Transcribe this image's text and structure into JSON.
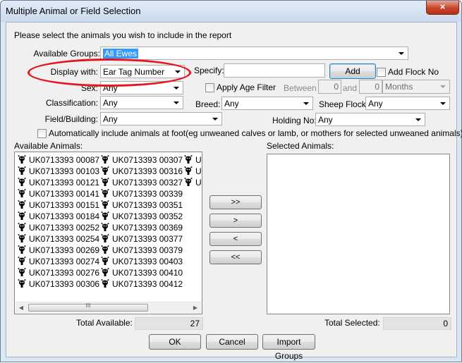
{
  "window": {
    "title": "Multiple Animal or Field Selection",
    "close_glyph": "×"
  },
  "instruction": "Please select the animals you wish to include in the report",
  "available_groups": {
    "label": "Available Groups:",
    "value": "All Ewes"
  },
  "display_with": {
    "label": "Display with:",
    "value": "Ear Tag Number"
  },
  "specify": {
    "label": "Specify:",
    "value": ""
  },
  "add_button": "Add",
  "add_flock_no": "Add Flock No",
  "sex": {
    "label": "Sex:",
    "value": "Any"
  },
  "apply_age_filter": "Apply Age Filter",
  "between": {
    "label": "Between",
    "from": "0",
    "and_label": "and",
    "to": "0",
    "unit": "Months"
  },
  "classification": {
    "label": "Classification:",
    "value": "Any"
  },
  "breed": {
    "label": "Breed:",
    "value": "Any"
  },
  "sheep_flock": {
    "label": "Sheep Flock:",
    "value": "Any"
  },
  "field_building": {
    "label": "Field/Building:",
    "value": "Any"
  },
  "holding_no": {
    "label": "Holding No:",
    "value": "Any"
  },
  "auto_include": "Automatically include animals at foot(eg unweaned calves or lamb, or mothers for selected unweaned animals)",
  "available_animals": {
    "label": "Available Animals:",
    "col1": [
      "UK0713393 00087",
      "UK0713393 00103",
      "UK0713393 00121",
      "UK0713393 00141",
      "UK0713393 00151",
      "UK0713393 00184",
      "UK0713393 00252",
      "UK0713393 00254",
      "UK0713393 00269",
      "UK0713393 00274",
      "UK0713393 00276",
      "UK0713393 00306"
    ],
    "col2": [
      "UK0713393 00307",
      "UK0713393 00316",
      "UK0713393 00327",
      "UK0713393 00339",
      "UK0713393 00351",
      "UK0713393 00352",
      "UK0713393 00369",
      "UK0713393 00377",
      "UK0713393 00379",
      "UK0713393 00403",
      "UK0713393 00410",
      "UK0713393 00412"
    ],
    "col3": [
      "U",
      "U",
      "U"
    ]
  },
  "selected_animals": {
    "label": "Selected Animals:"
  },
  "move_buttons": {
    "add_all": ">>",
    "add_one": ">",
    "remove_one": "<",
    "remove_all": "<<"
  },
  "total_available": {
    "label": "Total Available:",
    "value": "27"
  },
  "total_selected": {
    "label": "Total Selected:",
    "value": "0"
  },
  "footer": {
    "ok": "OK",
    "cancel": "Cancel",
    "import": "Import Groups"
  },
  "scroll_grip": "III",
  "annotation_color": "#e3171f"
}
